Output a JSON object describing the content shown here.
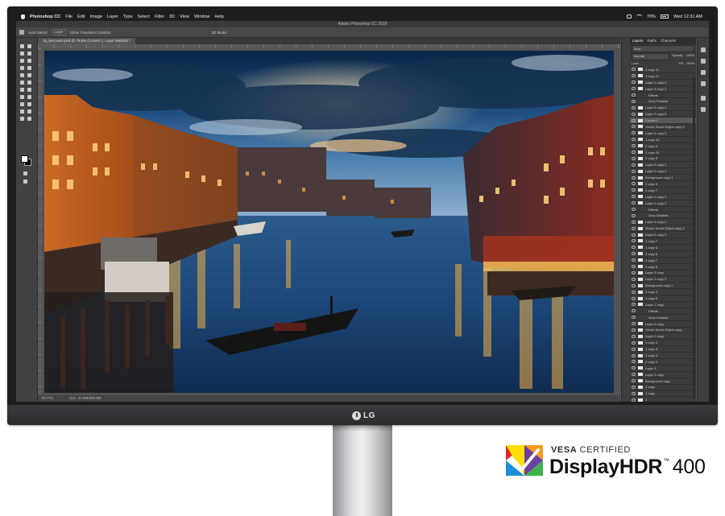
{
  "menubar": {
    "app": "Photoshop CC",
    "items": [
      "File",
      "Edit",
      "Image",
      "Layer",
      "Type",
      "Select",
      "Filter",
      "3D",
      "View",
      "Window",
      "Help"
    ],
    "battery": "70%",
    "clock": "Wed 12:31 AM"
  },
  "ps": {
    "window_title": "Adobe Photoshop CC 2018",
    "options": {
      "auto_select": "Auto-Select:",
      "auto_select_value": "Layer",
      "transform": "Show Transform Controls",
      "mode": "3D Mode:"
    },
    "doc_tab": "7p_lescream.psd @ 79.8% (Curves 1, Layer Mask/8) *",
    "status": {
      "zoom": "79.77%",
      "doc": "Doc: 31.9M/305.9M"
    },
    "panel": {
      "tabs": [
        "Layers",
        "Paths",
        "Channels"
      ],
      "kind": "Kind",
      "blend": "Normal",
      "opacity_label": "Opacity:",
      "opacity": "100%",
      "lock_label": "Lock:",
      "fill_label": "Fill:",
      "fill": "100%",
      "layers": [
        "2 copy 11",
        "1 copy 11",
        "Layer 1 copy 3",
        "Layer 3 copy 3",
        "Effects",
        "Drop Shadow",
        "Layer 4 copy 3",
        "Layer 2 copy 5",
        "Curves 1",
        "Vector Smart Object copy 3",
        "Layer 4 copy 2",
        "1 copy 10",
        "2 copy 9",
        "2 copy 10",
        "2 copy 8",
        "Layer 3 copy 2",
        "Layer 2 copy 4",
        "Background copy 3",
        "2 copy 8",
        "2 copy 7",
        "Layer 1 copy 2",
        "Layer 1 copy 2",
        "Effects",
        "Drop Shadow",
        "Layer 4 copy 2",
        "Vector Smart Object copy 2",
        "Layer 2 copy 3",
        "1 copy 7",
        "1 copy 6",
        "2 copy 6",
        "2 copy 7",
        "2 copy 5",
        "Layer 3 copy",
        "Layer 2 copy 2",
        "Background copy 2",
        "2 copy 4",
        "1 copy 5",
        "Layer 1 copy",
        "Effects",
        "Drop Shadow",
        "Layer 4 copy",
        "Vector Smart Object copy",
        "Layer 2 copy",
        "1 copy 4",
        "1 copy 3",
        "2 copy 3",
        "2 copy 2",
        "Layer 3",
        "Layer 2 copy",
        "Background copy",
        "2 copy",
        "1 copy",
        "2",
        "1",
        "Layer 1",
        "Layer 4"
      ]
    }
  },
  "monitor": {
    "brand": "LG"
  },
  "badge": {
    "vesa": "VESA",
    "certified": "CERTIFIED",
    "name": "DisplayHDR",
    "tm": "™",
    "level": "400",
    "logo_colors": [
      "#e4282a",
      "#f39a1e",
      "#ffe000",
      "#3cb44a",
      "#1a8fd6",
      "#6b3fa0"
    ]
  }
}
